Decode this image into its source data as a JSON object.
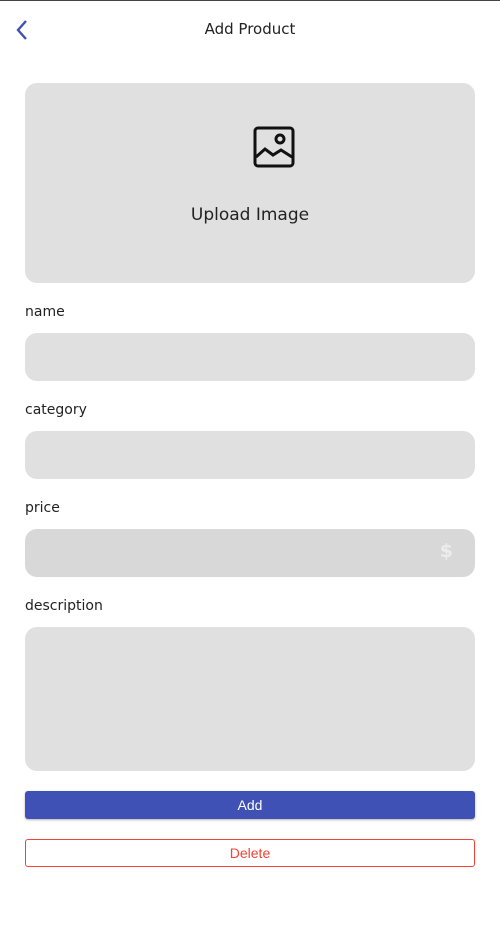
{
  "header": {
    "title": "Add Product",
    "back_icon": "chevron-left-icon"
  },
  "upload": {
    "label": "Upload Image",
    "icon": "image-icon"
  },
  "fields": {
    "name": {
      "label": "name",
      "value": ""
    },
    "category": {
      "label": "category",
      "value": ""
    },
    "price": {
      "label": "price",
      "value": "",
      "suffix": "$"
    },
    "description": {
      "label": "description",
      "value": ""
    }
  },
  "actions": {
    "add_label": "Add",
    "delete_label": "Delete"
  },
  "colors": {
    "primary": "#3f51b5",
    "danger": "#f44336",
    "field_bg": "#e0e0e0"
  }
}
